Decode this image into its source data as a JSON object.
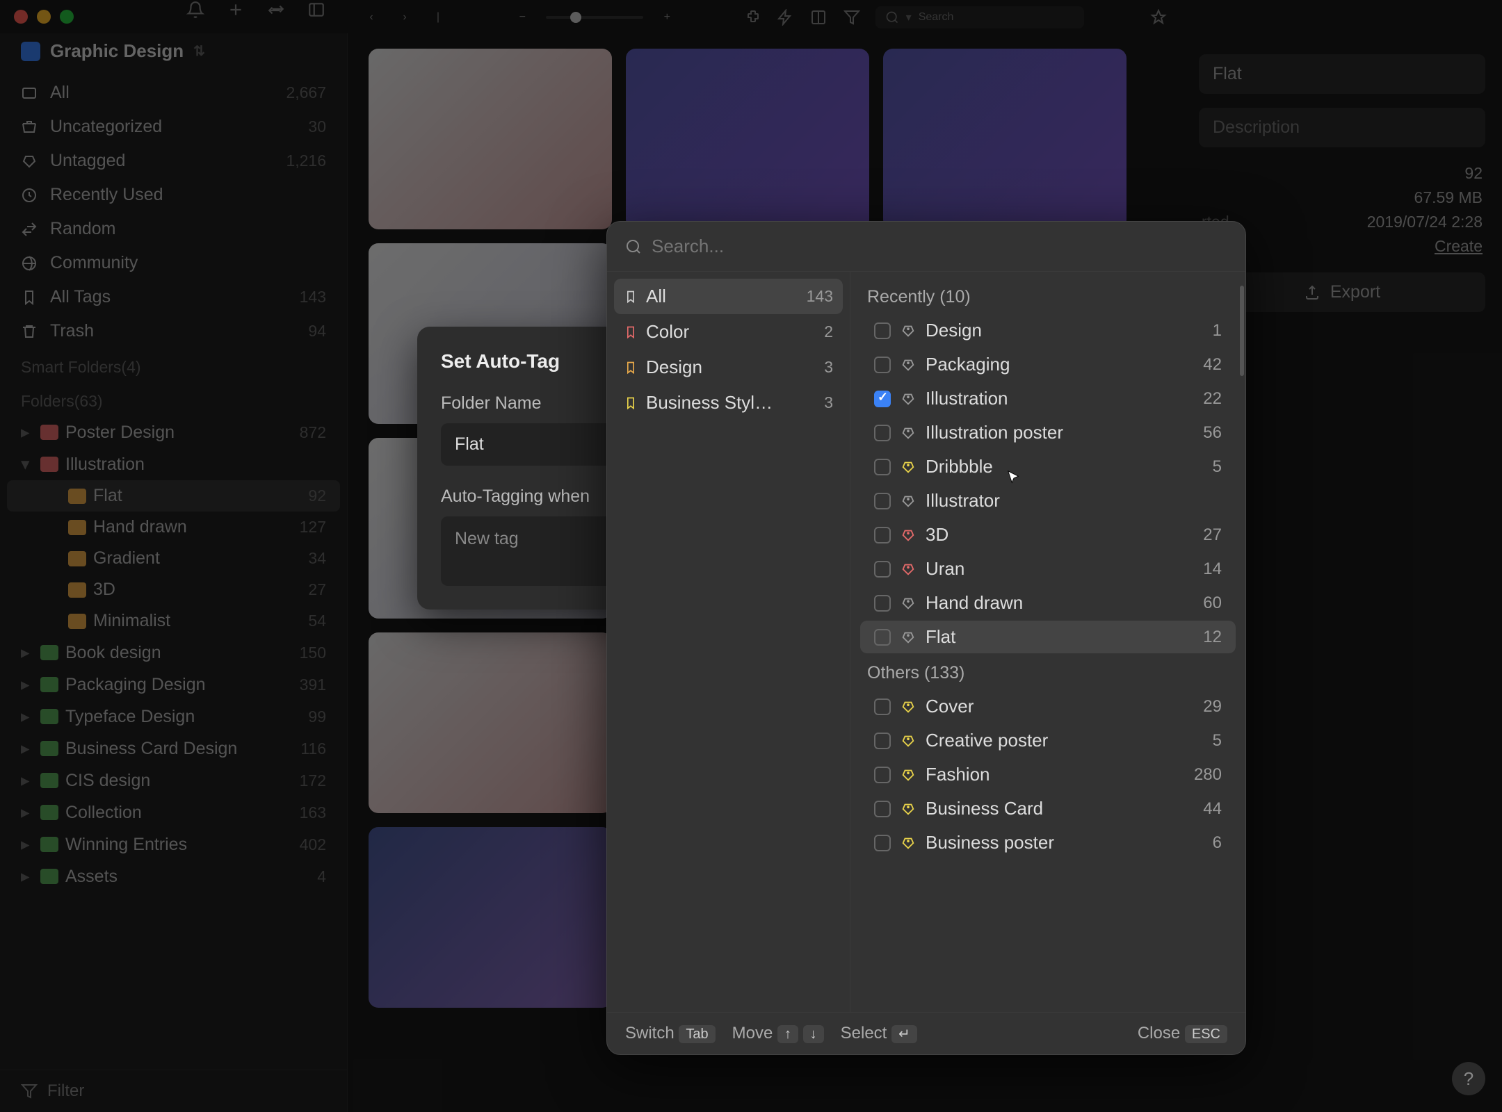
{
  "workspace": {
    "name": "Graphic Design"
  },
  "sidebar": {
    "items": [
      {
        "label": "All",
        "count": "2,667"
      },
      {
        "label": "Uncategorized",
        "count": "30"
      },
      {
        "label": "Untagged",
        "count": "1,216"
      },
      {
        "label": "Recently Used",
        "count": ""
      },
      {
        "label": "Random",
        "count": ""
      },
      {
        "label": "Community",
        "count": ""
      },
      {
        "label": "All Tags",
        "count": "143"
      },
      {
        "label": "Trash",
        "count": "94"
      }
    ],
    "smart_label": "Smart Folders(4)",
    "folders_label": "Folders(63)",
    "folders": [
      {
        "label": "Poster Design",
        "count": "872",
        "color": "#e46a6a"
      },
      {
        "label": "Illustration",
        "count": "",
        "color": "#e46a6a",
        "expanded": true
      },
      {
        "label": "Flat",
        "count": "92",
        "color": "#e8a94a",
        "sub": true,
        "selected": true
      },
      {
        "label": "Hand drawn",
        "count": "127",
        "color": "#e8a94a",
        "sub": true
      },
      {
        "label": "Gradient",
        "count": "34",
        "color": "#e8a94a",
        "sub": true
      },
      {
        "label": "3D",
        "count": "27",
        "color": "#e8a94a",
        "sub": true
      },
      {
        "label": "Minimalist",
        "count": "54",
        "color": "#e8a94a",
        "sub": true
      },
      {
        "label": "Book design",
        "count": "150",
        "color": "#5aa85a"
      },
      {
        "label": "Packaging Design",
        "count": "391",
        "color": "#5aa85a"
      },
      {
        "label": "Typeface Design",
        "count": "99",
        "color": "#5aa85a"
      },
      {
        "label": "Business Card Design",
        "count": "116",
        "color": "#5aa85a"
      },
      {
        "label": "CIS design",
        "count": "172",
        "color": "#5aa85a"
      },
      {
        "label": "Collection",
        "count": "163",
        "color": "#5aa85a"
      },
      {
        "label": "Winning Entries",
        "count": "402",
        "color": "#5aa85a"
      },
      {
        "label": "Assets",
        "count": "4",
        "color": "#5aa85a"
      }
    ],
    "filter_label": "Filter"
  },
  "toolbar": {
    "search_placeholder": "Search"
  },
  "inspector": {
    "title": "Flat",
    "description_placeholder": "Description",
    "rows": [
      {
        "label": "",
        "value": "92"
      },
      {
        "label": "",
        "value": "67.59 MB"
      },
      {
        "label": "rted",
        "value": "2019/07/24 2:28"
      },
      {
        "label": "",
        "value": "Create"
      }
    ],
    "export_label": "Export"
  },
  "autotag": {
    "title": "Set Auto-Tag",
    "folder_label": "Folder Name",
    "folder_value": "Flat",
    "when_label": "Auto-Tagging when",
    "new_tag_placeholder": "New tag"
  },
  "picker": {
    "search_placeholder": "Search...",
    "categories": [
      {
        "label": "All",
        "count": "143",
        "color": "#ccc",
        "active": true
      },
      {
        "label": "Color",
        "count": "2",
        "color": "#e46a6a"
      },
      {
        "label": "Design",
        "count": "3",
        "color": "#e8a94a"
      },
      {
        "label": "Business Styl…",
        "count": "3",
        "color": "#e8d24a"
      }
    ],
    "recent_header": "Recently (10)",
    "recent": [
      {
        "label": "Design",
        "count": "1",
        "color": "#999"
      },
      {
        "label": "Packaging",
        "count": "42",
        "color": "#999"
      },
      {
        "label": "Illustration",
        "count": "22",
        "color": "#999",
        "checked": true
      },
      {
        "label": "Illustration poster",
        "count": "56",
        "color": "#999"
      },
      {
        "label": "Dribbble",
        "count": "5",
        "color": "#e8d24a"
      },
      {
        "label": "Illustrator",
        "count": "",
        "color": "#999"
      },
      {
        "label": "3D",
        "count": "27",
        "color": "#e46a6a"
      },
      {
        "label": "Uran",
        "count": "14",
        "color": "#e46a6a"
      },
      {
        "label": "Hand drawn",
        "count": "60",
        "color": "#999"
      },
      {
        "label": "Flat",
        "count": "12",
        "color": "#999",
        "hover": true
      }
    ],
    "others_header": "Others (133)",
    "others": [
      {
        "label": "Cover",
        "count": "29",
        "color": "#e8d24a"
      },
      {
        "label": "Creative poster",
        "count": "5",
        "color": "#e8d24a"
      },
      {
        "label": "Fashion",
        "count": "280",
        "color": "#e8d24a"
      },
      {
        "label": "Business Card",
        "count": "44",
        "color": "#e8d24a"
      },
      {
        "label": "Business poster",
        "count": "6",
        "color": "#e8d24a"
      }
    ],
    "footer": {
      "switch": "Switch",
      "switch_key": "Tab",
      "move": "Move",
      "select": "Select",
      "select_key": "↵",
      "close": "Close",
      "close_key": "ESC"
    }
  }
}
